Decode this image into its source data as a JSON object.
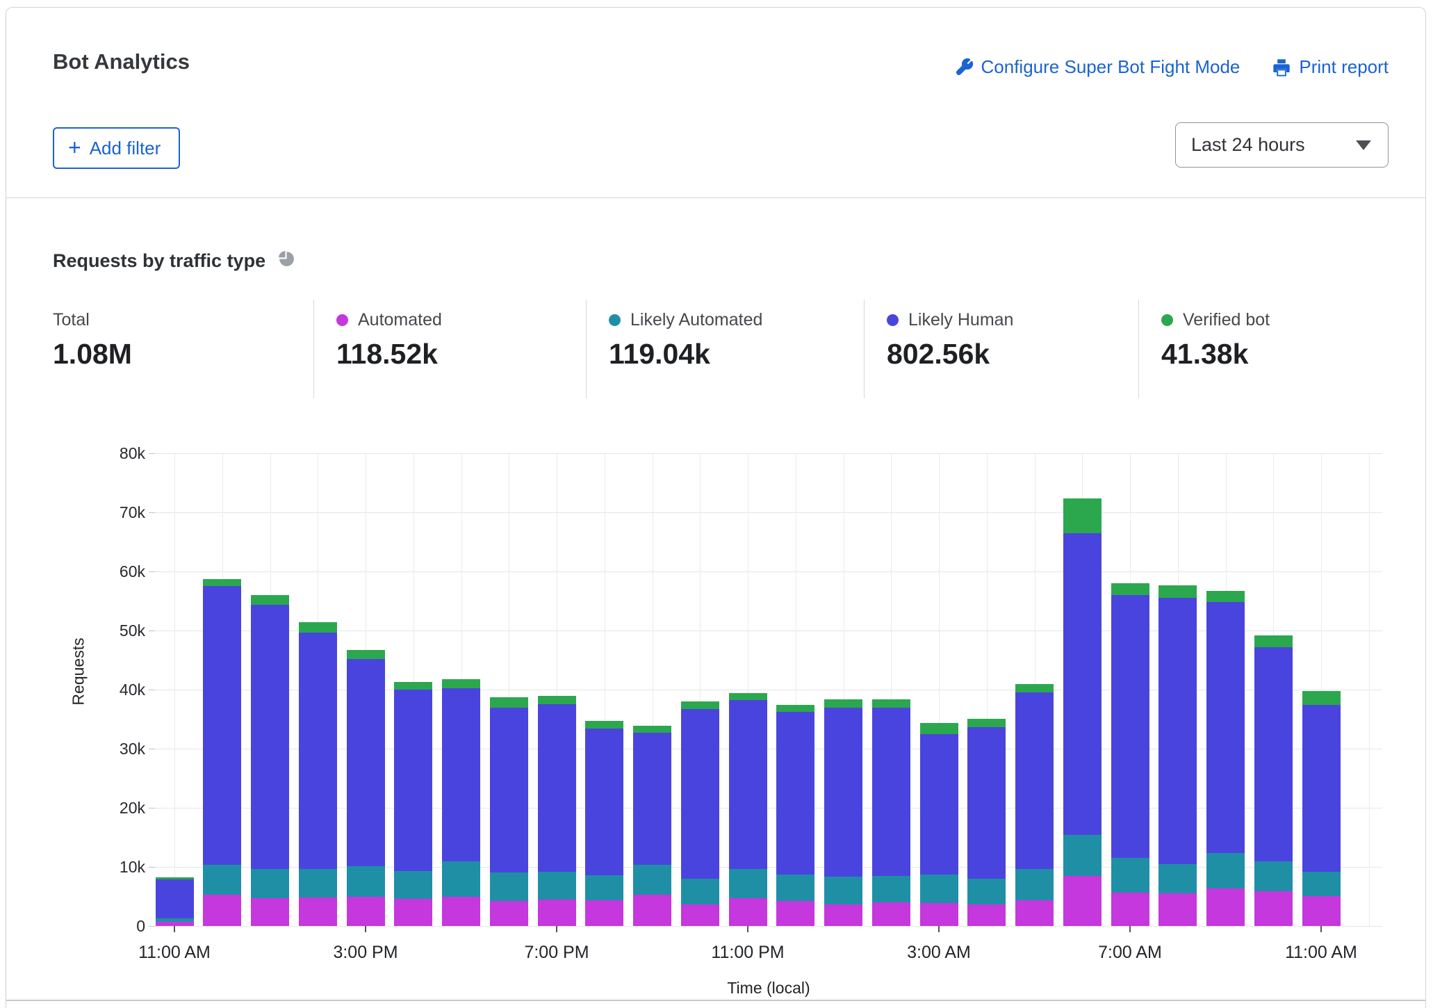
{
  "header": {
    "title": "Bot Analytics",
    "configure_link": "Configure Super Bot Fight Mode",
    "print_link": "Print report",
    "add_filter_label": "Add filter",
    "add_filter_plus": "+",
    "time_range_value": "Last 24 hours"
  },
  "section": {
    "heading": "Requests by traffic type"
  },
  "colors": {
    "automated": "#c438dd",
    "likely_automated": "#1f8fa6",
    "likely_human": "#4a44de",
    "verified_bot": "#2ba84e",
    "link_blue": "#1a63d2"
  },
  "stats": [
    {
      "label": "Total",
      "value": "1.08M",
      "color": null
    },
    {
      "label": "Automated",
      "value": "118.52k",
      "color": "#c438dd"
    },
    {
      "label": "Likely Automated",
      "value": "119.04k",
      "color": "#1f8fa6"
    },
    {
      "label": "Likely Human",
      "value": "802.56k",
      "color": "#4a44de"
    },
    {
      "label": "Verified bot",
      "value": "41.38k",
      "color": "#2ba84e"
    }
  ],
  "chart_data": {
    "type": "bar",
    "stacked": true,
    "title": "Requests by traffic type",
    "xlabel": "Time (local)",
    "ylabel": "Requests",
    "ylim": [
      0,
      80000
    ],
    "yticks": [
      "0",
      "10k",
      "20k",
      "30k",
      "40k",
      "50k",
      "60k",
      "70k",
      "80k"
    ],
    "x_tick_labels": [
      "11:00 AM",
      "3:00 PM",
      "7:00 PM",
      "11:00 PM",
      "3:00 AM",
      "7:00 AM",
      "11:00 AM"
    ],
    "x_tick_positions": [
      0,
      4,
      8,
      12,
      16,
      20,
      24
    ],
    "n_bars": 25,
    "grid": true,
    "series": [
      {
        "name": "Automated",
        "color": "#c438dd",
        "values": [
          700,
          5300,
          4700,
          4800,
          4900,
          4600,
          5000,
          4200,
          4500,
          4300,
          5300,
          3600,
          4700,
          4200,
          3700,
          4000,
          3900,
          3700,
          4300,
          8500,
          5700,
          5500,
          6400,
          5900,
          5100
        ]
      },
      {
        "name": "Likely Automated",
        "color": "#1f8fa6",
        "values": [
          600,
          5100,
          4900,
          4900,
          5200,
          4700,
          5900,
          4900,
          4700,
          4300,
          5000,
          4400,
          4900,
          4500,
          4600,
          4500,
          4800,
          4300,
          5300,
          6900,
          5800,
          5000,
          5900,
          5000,
          4100
        ]
      },
      {
        "name": "Likely Human",
        "color": "#4a44de",
        "values": [
          6600,
          47100,
          44700,
          39900,
          35100,
          30700,
          29300,
          27900,
          28300,
          24800,
          22400,
          28700,
          28600,
          27500,
          28700,
          28400,
          23800,
          25700,
          29900,
          51100,
          44500,
          45000,
          42500,
          36300,
          28200
        ]
      },
      {
        "name": "Verified bot",
        "color": "#2ba84e",
        "values": [
          300,
          1200,
          1700,
          1800,
          1500,
          1300,
          1600,
          1700,
          1500,
          1300,
          1200,
          1300,
          1200,
          1200,
          1300,
          1400,
          1900,
          1400,
          1400,
          5900,
          2000,
          2100,
          1900,
          2000,
          2400
        ]
      }
    ]
  }
}
